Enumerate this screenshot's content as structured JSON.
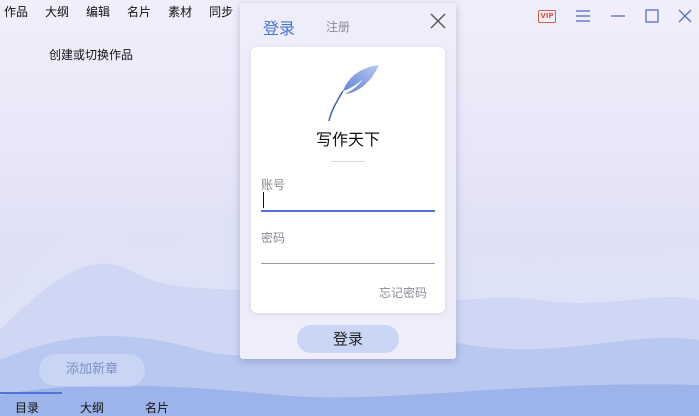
{
  "menu": {
    "items": [
      "作品",
      "大纲",
      "编辑",
      "名片",
      "素材",
      "同步"
    ]
  },
  "sidebar": {
    "switch_work_label": "创建或切换作品",
    "add_chapter_label": "添加新章",
    "bottom_tabs": [
      {
        "label": "目录",
        "active": true
      },
      {
        "label": "大纲",
        "active": false
      },
      {
        "label": "名片",
        "active": false
      }
    ]
  },
  "window_controls": {
    "vip_label": "VIP",
    "icons": [
      "vip-icon",
      "menu-icon",
      "minimize-icon",
      "maximize-icon",
      "close-icon"
    ]
  },
  "login_dialog": {
    "tab_login": "登录",
    "tab_register": "注册",
    "brand_name": "写作天下",
    "account_label": "账号",
    "account_value": "",
    "password_label": "密码",
    "password_value": "",
    "forgot_password": "忘记密码",
    "login_button": "登录",
    "accent_color": "#4a74d6"
  }
}
